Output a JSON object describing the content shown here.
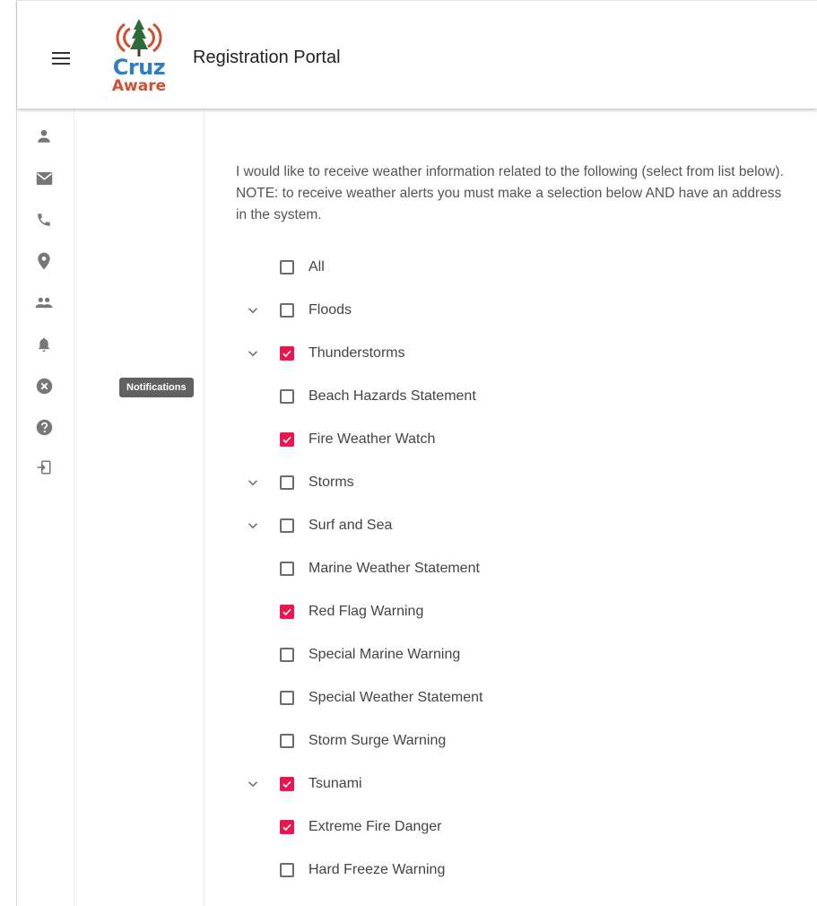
{
  "header": {
    "title": "Registration Portal",
    "logo_line_1": "Cruz",
    "logo_line_2": "Aware"
  },
  "sidebar": {
    "items": [
      {
        "icon": "person-icon"
      },
      {
        "icon": "mail-icon"
      },
      {
        "icon": "phone-icon"
      },
      {
        "icon": "location-icon"
      },
      {
        "icon": "group-icon"
      },
      {
        "icon": "bell-icon"
      },
      {
        "icon": "cancel-icon"
      },
      {
        "icon": "help-icon"
      },
      {
        "icon": "logout-icon"
      }
    ],
    "tooltip": "Notifications"
  },
  "main": {
    "intro": "I would like to receive weather information related to the following (select from list below). NOTE: to receive weather alerts you must make a selection below AND have an address in the system.",
    "options": [
      {
        "label": "All",
        "checked": false,
        "expandable": false
      },
      {
        "label": "Floods",
        "checked": false,
        "expandable": true
      },
      {
        "label": "Thunderstorms",
        "checked": true,
        "expandable": true
      },
      {
        "label": "Beach Hazards Statement",
        "checked": false,
        "expandable": false
      },
      {
        "label": "Fire Weather Watch",
        "checked": true,
        "expandable": false
      },
      {
        "label": "Storms",
        "checked": false,
        "expandable": true
      },
      {
        "label": "Surf and Sea",
        "checked": false,
        "expandable": true
      },
      {
        "label": "Marine Weather Statement",
        "checked": false,
        "expandable": false
      },
      {
        "label": "Red Flag Warning",
        "checked": true,
        "expandable": false
      },
      {
        "label": "Special Marine Warning",
        "checked": false,
        "expandable": false
      },
      {
        "label": "Special Weather Statement",
        "checked": false,
        "expandable": false
      },
      {
        "label": "Storm Surge Warning",
        "checked": false,
        "expandable": false
      },
      {
        "label": "Tsunami",
        "checked": true,
        "expandable": true
      },
      {
        "label": "Extreme Fire Danger",
        "checked": true,
        "expandable": false
      },
      {
        "label": "Hard Freeze Warning",
        "checked": false,
        "expandable": false
      }
    ]
  },
  "colors": {
    "accent": "#e8184f",
    "icon": "#777777",
    "logo_blue": "#2f7fc4",
    "logo_red": "#d0502f"
  }
}
